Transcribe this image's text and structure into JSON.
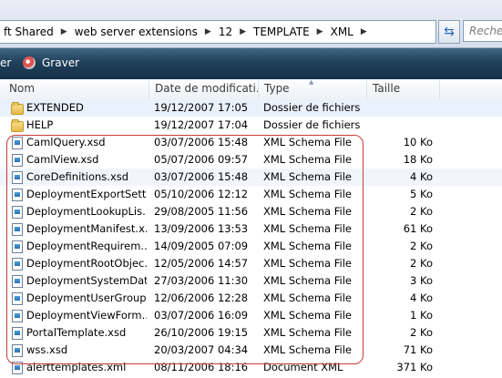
{
  "address_bar": {
    "breadcrumbs": [
      "ft Shared",
      "web server extensions",
      "12",
      "TEMPLATE",
      "XML"
    ],
    "search_placeholder": "Recher"
  },
  "command_bar": {
    "left_label": "er",
    "burn_label": "Graver"
  },
  "columns": {
    "name": "Nom",
    "date": "Date de modificati...",
    "type": "Type",
    "size": "Taille"
  },
  "files": [
    {
      "name": "EXTENDED",
      "date": "19/12/2007 17:05",
      "type": "Dossier de fichiers",
      "size": "",
      "kind": "folder"
    },
    {
      "name": "HELP",
      "date": "19/12/2007 17:04",
      "type": "Dossier de fichiers",
      "size": "",
      "kind": "folder"
    },
    {
      "name": "CamlQuery.xsd",
      "date": "03/07/2006 15:48",
      "type": "XML Schema File",
      "size": "10 Ko",
      "kind": "doc"
    },
    {
      "name": "CamlView.xsd",
      "date": "05/07/2006 09:57",
      "type": "XML Schema File",
      "size": "18 Ko",
      "kind": "doc"
    },
    {
      "name": "CoreDefinitions.xsd",
      "date": "03/07/2006 15:48",
      "type": "XML Schema File",
      "size": "4 Ko",
      "kind": "doc"
    },
    {
      "name": "DeploymentExportSetti...",
      "date": "05/10/2006 12:12",
      "type": "XML Schema File",
      "size": "5 Ko",
      "kind": "doc"
    },
    {
      "name": "DeploymentLookupLis...",
      "date": "29/08/2005 11:56",
      "type": "XML Schema File",
      "size": "2 Ko",
      "kind": "doc"
    },
    {
      "name": "DeploymentManifest.x...",
      "date": "13/09/2006 13:53",
      "type": "XML Schema File",
      "size": "61 Ko",
      "kind": "doc"
    },
    {
      "name": "DeploymentRequirem...",
      "date": "14/09/2005 07:09",
      "type": "XML Schema File",
      "size": "2 Ko",
      "kind": "doc"
    },
    {
      "name": "DeploymentRootObjec...",
      "date": "12/05/2006 14:57",
      "type": "XML Schema File",
      "size": "2 Ko",
      "kind": "doc"
    },
    {
      "name": "DeploymentSystemDat...",
      "date": "27/03/2006 11:30",
      "type": "XML Schema File",
      "size": "3 Ko",
      "kind": "doc"
    },
    {
      "name": "DeploymentUserGroup...",
      "date": "12/06/2006 12:28",
      "type": "XML Schema File",
      "size": "4 Ko",
      "kind": "doc"
    },
    {
      "name": "DeploymentViewForm...",
      "date": "03/07/2006 16:09",
      "type": "XML Schema File",
      "size": "1 Ko",
      "kind": "doc"
    },
    {
      "name": "PortalTemplate.xsd",
      "date": "26/10/2006 19:15",
      "type": "XML Schema File",
      "size": "2 Ko",
      "kind": "doc"
    },
    {
      "name": "wss.xsd",
      "date": "20/03/2007 04:34",
      "type": "XML Schema File",
      "size": "71 Ko",
      "kind": "doc"
    },
    {
      "name": "alerttemplates.xml",
      "date": "08/11/2006 18:16",
      "type": "Document XML",
      "size": "371 Ko",
      "kind": "doc"
    }
  ]
}
